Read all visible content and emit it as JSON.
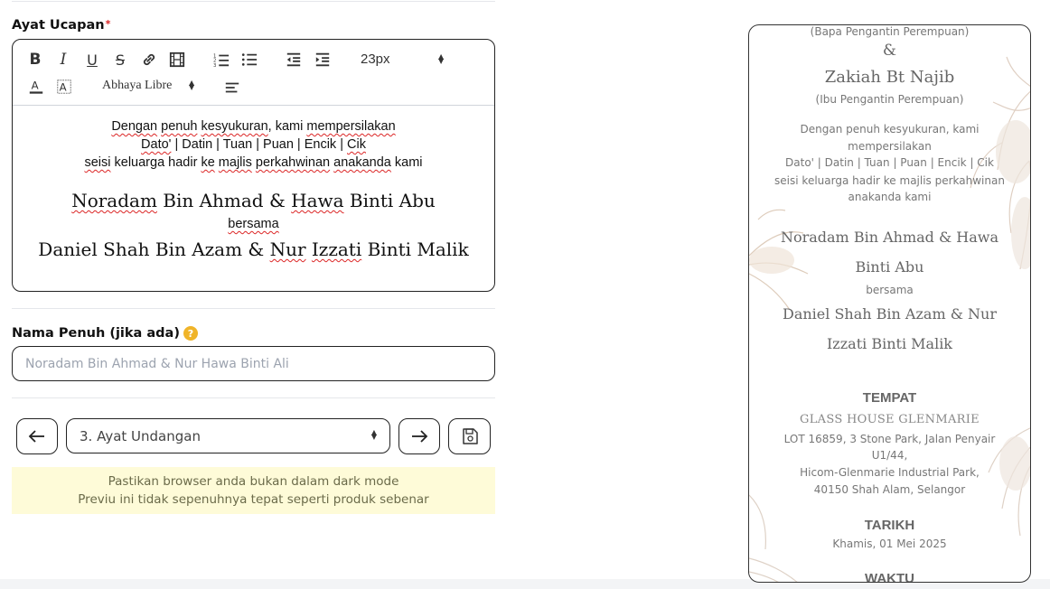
{
  "editor": {
    "label": "Ayat Ucapan",
    "required_mark": "*",
    "toolbar": {
      "font_size": "23px",
      "font_family": "Abhaya Libre"
    },
    "content": {
      "line1_a": "Dengan",
      "line1_b": "penuh",
      "line1_c": "kesyukuran",
      "line1_d": ", kami",
      "line1_e": "mempersilakan",
      "line2_a": "Dato'",
      "line2_b": " | Datin | Tuan | Puan | Encik | ",
      "line2_c": "Cik",
      "line3_a": "seisi",
      "line3_b": " keluarga hadir ",
      "line3_c": "ke",
      "line3_d": "majlis",
      "line3_e": "perkahwinan",
      "line3_f": "anakanda",
      "line3_g": " kami",
      "names1_a": "Noradam",
      "names1_b": " Bin Ahmad & ",
      "names1_c": "Hawa",
      "names1_d": " Binti Abu",
      "bersama": "bersama",
      "names2_a": "Daniel Shah Bin Azam & ",
      "names2_b": "Nur",
      "names2_c": "Izzati",
      "names2_d": " Binti Malik"
    }
  },
  "full_name": {
    "label": "Nama Penuh (jika ada)",
    "help": "?",
    "placeholder": "Noradam Bin Ahmad & Nur Hawa Binti Ali"
  },
  "nav": {
    "step_select": "3. Ayat Undangan"
  },
  "notice": {
    "line1": "Pastikan browser anda bukan dalam dark mode",
    "line2": "Previu ini tidak sepenuhnya tepat seperti produk sebenar"
  },
  "preview": {
    "father_role": "(Bapa Pengantin Perempuan)",
    "ampersand": "&",
    "mother_name": "Zakiah Bt Najib",
    "mother_role": "(Ibu Pengantin Perempuan)",
    "greet1": "Dengan penuh kesyukuran, kami",
    "greet2": "mempersilakan",
    "greet3": "Dato' | Datin | Tuan | Puan | Encik | Cik",
    "greet4": "seisi keluarga hadir ke majlis perkahwinan",
    "greet5": "anakanda kami",
    "names1a": "Noradam Bin Ahmad & Hawa",
    "names1b": "Binti Abu",
    "bersama": "bersama",
    "names2a": "Daniel Shah Bin Azam & Nur",
    "names2b": "Izzati Binti Malik",
    "venue_heading": "TEMPAT",
    "venue_name": "GLASS HOUSE GLENMARIE",
    "addr1": "LOT 16859, 3 Stone Park, Jalan Penyair",
    "addr2": "U1/44,",
    "addr3": "Hicom-Glenmarie Industrial Park,",
    "addr4": "40150 Shah Alam, Selangor",
    "date_heading": "TARIKH",
    "date_value": "Khamis, 01 Mei 2025",
    "time_heading": "WAKTU"
  }
}
